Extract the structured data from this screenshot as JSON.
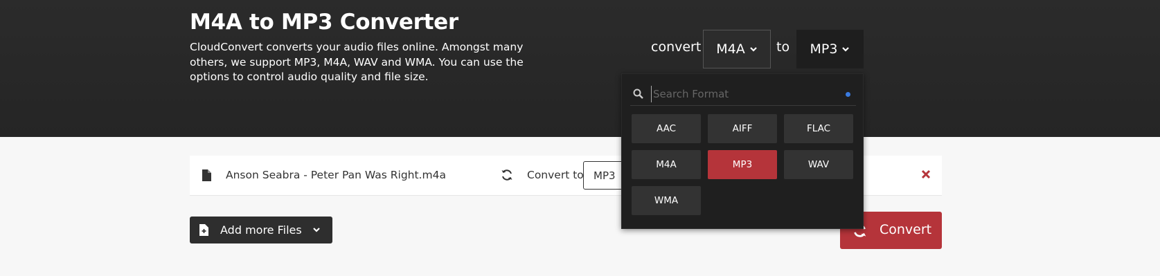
{
  "hero": {
    "title": "M4A to MP3 Converter",
    "description": "CloudConvert converts your audio files online. Amongst many others, we support MP3, M4A, WAV and WMA. You can use the options to control audio quality and file size."
  },
  "format_picker": {
    "convert_label": "convert",
    "from_format": "M4A",
    "to_label": "to",
    "to_format": "MP3"
  },
  "dropdown": {
    "search_placeholder": "Search Format",
    "options": [
      {
        "label": "AAC",
        "selected": false
      },
      {
        "label": "AIFF",
        "selected": false
      },
      {
        "label": "FLAC",
        "selected": false
      },
      {
        "label": "M4A",
        "selected": false
      },
      {
        "label": "MP3",
        "selected": true
      },
      {
        "label": "WAV",
        "selected": false
      },
      {
        "label": "WMA",
        "selected": false
      }
    ]
  },
  "file": {
    "name": "Anson Seabra - Peter Pan Was Right.m4a",
    "convert_to_label": "Convert to",
    "selected_format": "MP3"
  },
  "actions": {
    "add_files_label": "Add more Files",
    "convert_label": "Convert"
  },
  "colors": {
    "accent_red": "#b5343a",
    "hero_bg": "#2b2b2b",
    "dropdown_bg": "#1f1f1f",
    "focus_dot": "#3a7be0"
  },
  "icons": [
    "search-icon",
    "file-icon",
    "sync-icon",
    "close-icon",
    "chevron-down-icon",
    "file-plus-icon"
  ]
}
